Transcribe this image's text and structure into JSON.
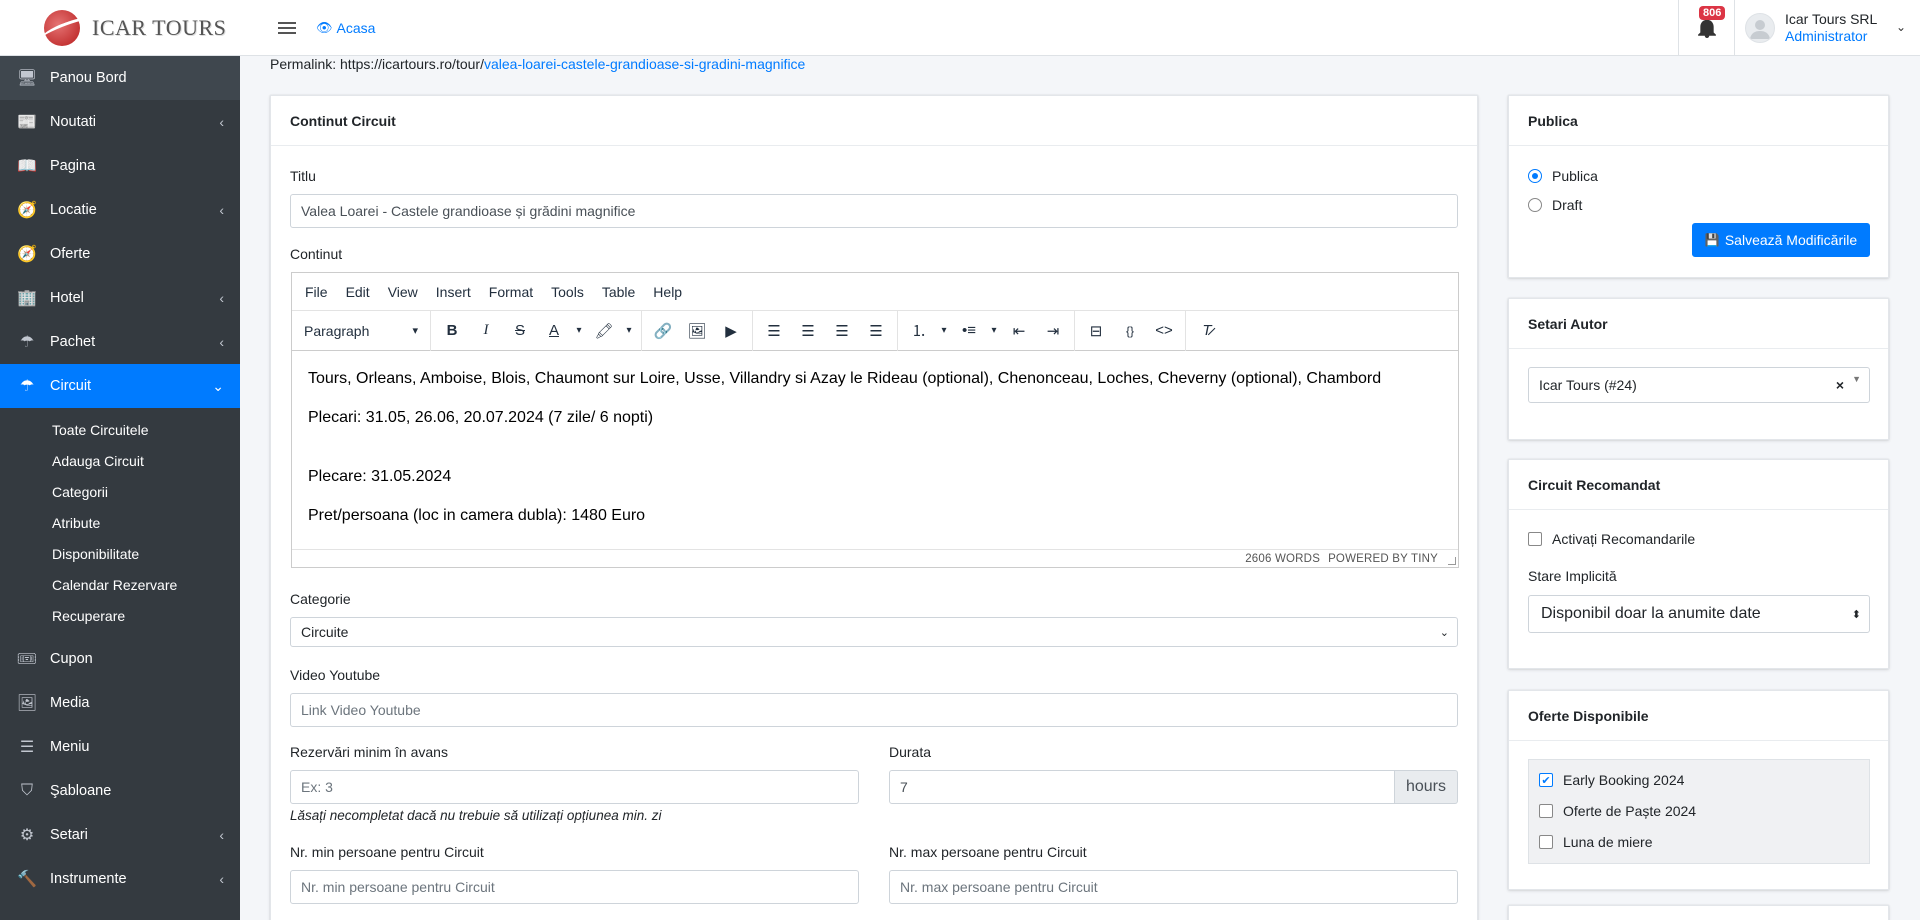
{
  "brand": {
    "name": "ICAR TOURS"
  },
  "sidebar": {
    "items": [
      {
        "label": "Panou Bord",
        "icon": "monitor-icon",
        "glyph": "🖥",
        "has_chevron": false
      },
      {
        "label": "Noutati",
        "icon": "newspaper-icon",
        "glyph": "📰",
        "has_chevron": true
      },
      {
        "label": "Pagina",
        "icon": "book-icon",
        "glyph": "📖",
        "has_chevron": false
      },
      {
        "label": "Locatie",
        "icon": "compass-icon",
        "glyph": "🧭",
        "has_chevron": true
      },
      {
        "label": "Oferte",
        "icon": "compass-icon",
        "glyph": "🧭",
        "has_chevron": false
      },
      {
        "label": "Hotel",
        "icon": "building-icon",
        "glyph": "🏢",
        "has_chevron": true
      },
      {
        "label": "Pachet",
        "icon": "umbrella-icon",
        "glyph": "☂",
        "has_chevron": true
      },
      {
        "label": "Circuit",
        "icon": "umbrella-icon",
        "glyph": "☂",
        "has_chevron": true,
        "active": true
      }
    ],
    "subitems": [
      "Toate Circuitele",
      "Adauga Circuit",
      "Categorii",
      "Atribute",
      "Disponibilitate",
      "Calendar Rezervare",
      "Recuperare"
    ],
    "items_after": [
      {
        "label": "Cupon",
        "icon": "ticket-icon",
        "glyph": "🎟",
        "has_chevron": false
      },
      {
        "label": "Media",
        "icon": "image-icon",
        "glyph": "🖼",
        "has_chevron": false
      },
      {
        "label": "Meniu",
        "icon": "layers-icon",
        "glyph": "☰",
        "has_chevron": false
      },
      {
        "label": "Şabloane",
        "icon": "html5-icon",
        "glyph": "⛉",
        "has_chevron": false
      },
      {
        "label": "Setari",
        "icon": "gear-icon",
        "glyph": "⚙",
        "has_chevron": true
      },
      {
        "label": "Instrumente",
        "icon": "hammer-icon",
        "glyph": "🔨",
        "has_chevron": true
      }
    ]
  },
  "header": {
    "home_label": "Acasa",
    "notification_count": "806",
    "user_name": "Icar Tours SRL",
    "user_role": "Administrator"
  },
  "permalink": {
    "prefix": "Permalink: https://icartours.ro/tour/",
    "slug": "valea-loarei-castele-grandioase-si-gradini-magnifice"
  },
  "main": {
    "card_title": "Continut Circuit",
    "title_label": "Titlu",
    "title_value": "Valea Loarei - Castele grandioase și grădini magnifice",
    "content_label": "Continut",
    "editor": {
      "menu": [
        "File",
        "Edit",
        "View",
        "Insert",
        "Format",
        "Tools",
        "Table",
        "Help"
      ],
      "block_format": "Paragraph",
      "paragraphs": [
        "Tours, Orleans, Amboise, Blois, Chaumont sur Loire, Usse, Villandry si Azay le Rideau (optional),  Chenonceau, Loches, Cheverny (optional), Chambord",
        "Plecari: 31.05, 26.06, 20.07.2024 (7 zile/ 6 nopti)",
        "Plecare: 31.05.2024",
        "Pret/persoana (loc in camera dubla): 1480 Euro"
      ],
      "word_count": "2606 WORDS",
      "powered_by": "POWERED BY TINY"
    },
    "category_label": "Categorie",
    "category_value": "Circuite",
    "youtube_label": "Video Youtube",
    "youtube_placeholder": "Link Video Youtube",
    "min_booking_label": "Rezervări minim în avans",
    "min_booking_placeholder": "Ex: 3",
    "min_booking_help": "Lăsați necompletat dacă nu trebuie să utilizați opțiunea min. zi",
    "duration_label": "Durata",
    "duration_value": "7",
    "duration_unit": "hours",
    "min_persons_label": "Nr. min persoane pentru Circuit",
    "min_persons_placeholder": "Nr. min persoane pentru Circuit",
    "max_persons_label": "Nr. max persoane pentru Circuit",
    "max_persons_placeholder": "Nr. max persoane pentru Circuit"
  },
  "publish": {
    "title": "Publica",
    "options": [
      "Publica",
      "Draft"
    ],
    "selected": "Publica",
    "save_label": "Salvează Modificările"
  },
  "author": {
    "title": "Setari Autor",
    "value": "Icar Tours (#24)",
    "clear": "×"
  },
  "recommended": {
    "title": "Circuit Recomandat",
    "activate_label": "Activați Recomandarile",
    "default_state_label": "Stare Implicită",
    "default_state_value": "Disponibil doar la anumite date"
  },
  "offers": {
    "title": "Oferte Disponibile",
    "items": [
      {
        "label": "Early Booking 2024",
        "checked": true
      },
      {
        "label": "Oferte de Paște 2024",
        "checked": false
      },
      {
        "label": "Luna de miere",
        "checked": false
      }
    ]
  },
  "colors": {
    "sidebar_bg": "#343a40",
    "active": "#007bff",
    "badge": "#dc3545"
  }
}
